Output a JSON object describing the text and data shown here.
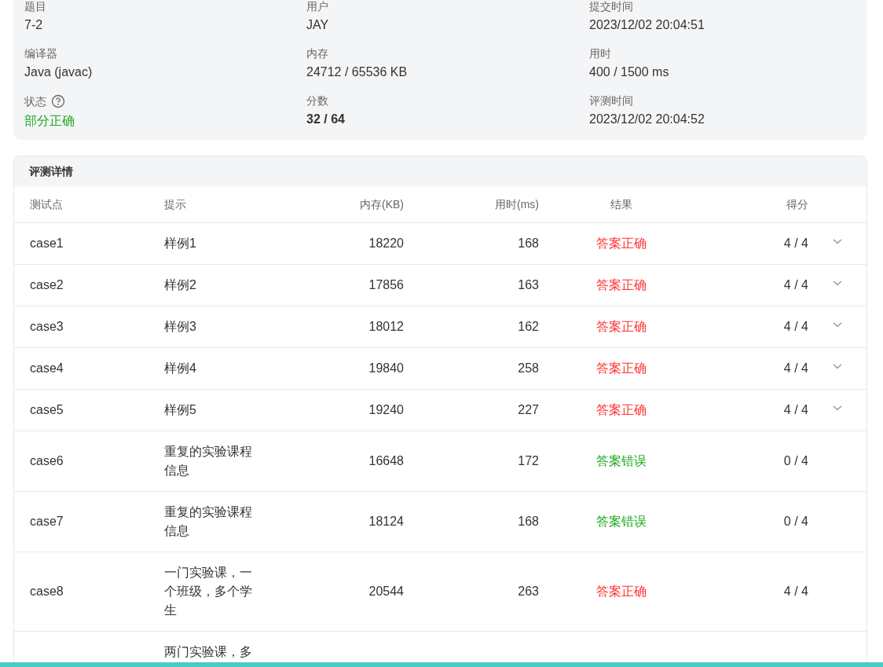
{
  "summary": [
    {
      "label": "题目",
      "value": "7-2"
    },
    {
      "label": "用户",
      "value": "JAY"
    },
    {
      "label": "提交时间",
      "value": "2023/12/02 20:04:51"
    },
    {
      "label": "编译器",
      "value": "Java (javac)"
    },
    {
      "label": "内存",
      "value": "24712 / 65536 KB"
    },
    {
      "label": "用时",
      "value": "400 / 1500 ms"
    },
    {
      "label": "状态",
      "value": "部分正确",
      "kind": "status",
      "help": true,
      "color": "#1faa1f"
    },
    {
      "label": "分数",
      "value": "32 / 64",
      "kind": "score"
    },
    {
      "label": "评测时间",
      "value": "2023/12/02 20:04:52"
    }
  ],
  "details": {
    "title": "评测详情",
    "columns": [
      "测试点",
      "提示",
      "内存(KB)",
      "用时(ms)",
      "结果",
      "得分"
    ],
    "rows": [
      {
        "case": "case1",
        "hint": "样例1",
        "memory": "18220",
        "time": "168",
        "result": "答案正确",
        "color": "#ff3333",
        "score": "4 / 4",
        "expandable": true
      },
      {
        "case": "case2",
        "hint": "样例2",
        "memory": "17856",
        "time": "163",
        "result": "答案正确",
        "color": "#ff3333",
        "score": "4 / 4",
        "expandable": true
      },
      {
        "case": "case3",
        "hint": "样例3",
        "memory": "18012",
        "time": "162",
        "result": "答案正确",
        "color": "#ff3333",
        "score": "4 / 4",
        "expandable": true
      },
      {
        "case": "case4",
        "hint": "样例4",
        "memory": "19840",
        "time": "258",
        "result": "答案正确",
        "color": "#ff3333",
        "score": "4 / 4",
        "expandable": true
      },
      {
        "case": "case5",
        "hint": "样例5",
        "memory": "19240",
        "time": "227",
        "result": "答案正确",
        "color": "#ff3333",
        "score": "4 / 4",
        "expandable": true
      },
      {
        "case": "case6",
        "hint": "重复的实验课程信息",
        "memory": "16648",
        "time": "172",
        "result": "答案错误",
        "color": "#1faa1f",
        "score": "0 / 4",
        "expandable": false
      },
      {
        "case": "case7",
        "hint": "重复的实验课程信息",
        "memory": "18124",
        "time": "168",
        "result": "答案错误",
        "color": "#1faa1f",
        "score": "0 / 4",
        "expandable": false
      },
      {
        "case": "case8",
        "hint": "一门实验课，一个班级，多个学生",
        "memory": "20544",
        "time": "263",
        "result": "答案正确",
        "color": "#ff3333",
        "score": "4 / 4",
        "expandable": false
      },
      {
        "hint": "两门实验课，多"
      }
    ]
  }
}
